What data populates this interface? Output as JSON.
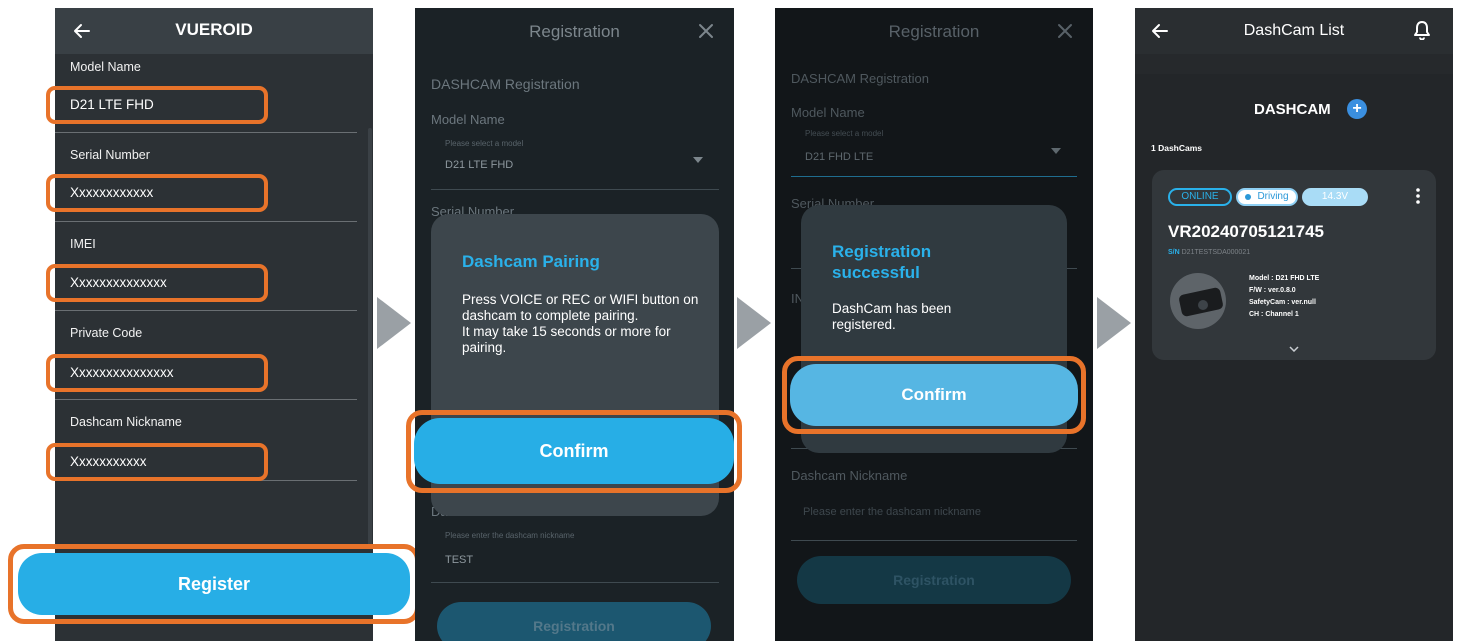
{
  "screen1": {
    "title": "VUEROID",
    "fields": [
      {
        "label": "Model Name",
        "value": "D21 LTE FHD"
      },
      {
        "label": "Serial Number",
        "value": "Xxxxxxxxxxxx"
      },
      {
        "label": "IMEI",
        "value": "Xxxxxxxxxxxxxx"
      },
      {
        "label": "Private Code",
        "value": "Xxxxxxxxxxxxxxx"
      },
      {
        "label": "Dashcam Nickname",
        "value": "Xxxxxxxxxxx"
      }
    ],
    "register_label": "Register"
  },
  "screen2": {
    "title": "Registration",
    "section_title": "DASHCAM Registration",
    "model_label": "Model Name",
    "model_hint": "Please select a model",
    "model_value": "D21 LTE FHD",
    "serial_label_partial": "Serial Number",
    "nickname_label_partial": "Dashcam Nickname",
    "nickname_hint": "Please enter the dashcam nickname",
    "nickname_value": "TEST",
    "registration_button": "Registration",
    "dialog_title": "Dashcam Pairing",
    "dialog_body": "Press VOICE or REC or WIFI button on dashcam to complete pairing.\nIt may take 15 seconds or more for pairing.",
    "confirm_label": "Confirm"
  },
  "screen3": {
    "title": "Registration",
    "section_title": "DASHCAM Registration",
    "model_label": "Model Name",
    "model_hint": "Please select a model",
    "model_value": "D21 FHD LTE",
    "serial_label_partial": "Serial Number",
    "imei_partial": "IN",
    "nickname_label": "Dashcam Nickname",
    "nickname_hint": "Please enter the dashcam nickname",
    "registration_button": "Registration",
    "dialog_title": "Registration\nsuccessful",
    "dialog_body": "DashCam has been\nregistered.",
    "confirm_label": "Confirm"
  },
  "screen4": {
    "title": "DashCam List",
    "section_title": "DASHCAM",
    "count_label": "1 DashCams",
    "status_online": "ONLINE",
    "status_driving": "Driving",
    "voltage": "14.3V",
    "device_name": "VR20240705121745",
    "sn_prefix": "S/N",
    "sn_value": "D21TESTSDA000021",
    "specs": [
      "Model : D21 FHD LTE",
      "F/W : ver.0.8.0",
      "SafetyCam : ver.null",
      "CH : Channel 1"
    ]
  },
  "colors": {
    "accent_blue": "#27aee6",
    "highlight_orange": "#e8732a"
  }
}
